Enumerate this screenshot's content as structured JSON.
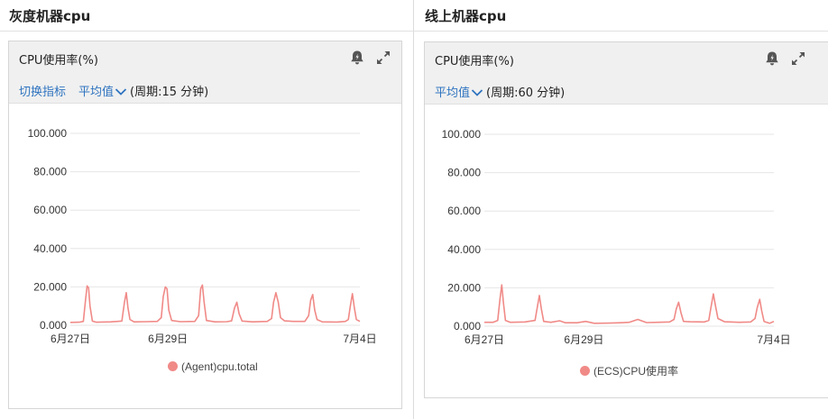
{
  "colors": {
    "link": "#2f74c0",
    "series": "#f08a87",
    "grid": "#e6e6e6"
  },
  "panels": [
    {
      "section_title": "灰度机器cpu",
      "card_title": "CPU使用率(%)",
      "alert_icon": "bell-alert-icon",
      "expand_icon": "expand-icon",
      "switch_metric_label": "切换指标",
      "aggregation_label": "平均值",
      "period_label": "(周期:15 分钟)",
      "legend_label": "(Agent)cpu.total",
      "chart_data": {
        "type": "line",
        "yticks": [
          "100.000",
          "80.000",
          "60.000",
          "40.000",
          "20.000",
          "0.000"
        ],
        "ylim": [
          0,
          100
        ],
        "x_tick_labels": [
          "6月27日",
          "6月29日",
          "7月4日"
        ],
        "x_tick_positions": [
          0.0,
          0.337,
          1.0
        ],
        "series": [
          {
            "name": "(Agent)cpu.total",
            "points": [
              [
                0.0,
                1.5
              ],
              [
                0.03,
                1.6
              ],
              [
                0.045,
                2.0
              ],
              [
                0.053,
                14.0
              ],
              [
                0.058,
                20.5
              ],
              [
                0.063,
                19.5
              ],
              [
                0.068,
                10.0
              ],
              [
                0.076,
                2.2
              ],
              [
                0.09,
                1.6
              ],
              [
                0.14,
                1.8
              ],
              [
                0.178,
                2.2
              ],
              [
                0.187,
                12.0
              ],
              [
                0.193,
                17.0
              ],
              [
                0.199,
                9.0
              ],
              [
                0.206,
                3.0
              ],
              [
                0.22,
                1.8
              ],
              [
                0.26,
                1.9
              ],
              [
                0.3,
                2.0
              ],
              [
                0.314,
                4.0
              ],
              [
                0.321,
                15.0
              ],
              [
                0.328,
                20.0
              ],
              [
                0.334,
                19.0
              ],
              [
                0.34,
                8.0
              ],
              [
                0.35,
                2.5
              ],
              [
                0.38,
                1.9
              ],
              [
                0.43,
                2.0
              ],
              [
                0.443,
                5.0
              ],
              [
                0.45,
                19.0
              ],
              [
                0.456,
                21.0
              ],
              [
                0.462,
                12.0
              ],
              [
                0.47,
                2.5
              ],
              [
                0.5,
                1.8
              ],
              [
                0.54,
                1.9
              ],
              [
                0.557,
                2.3
              ],
              [
                0.567,
                9.0
              ],
              [
                0.575,
                12.0
              ],
              [
                0.583,
                6.0
              ],
              [
                0.593,
                2.2
              ],
              [
                0.63,
                1.8
              ],
              [
                0.68,
                2.0
              ],
              [
                0.695,
                3.5
              ],
              [
                0.702,
                12.0
              ],
              [
                0.71,
                17.0
              ],
              [
                0.718,
                12.0
              ],
              [
                0.726,
                4.0
              ],
              [
                0.74,
                2.3
              ],
              [
                0.77,
                2.0
              ],
              [
                0.81,
                2.0
              ],
              [
                0.823,
                5.0
              ],
              [
                0.83,
                13.0
              ],
              [
                0.837,
                16.0
              ],
              [
                0.844,
                8.0
              ],
              [
                0.852,
                3.0
              ],
              [
                0.87,
                1.8
              ],
              [
                0.92,
                1.7
              ],
              [
                0.95,
                2.0
              ],
              [
                0.96,
                3.0
              ],
              [
                0.967,
                10.0
              ],
              [
                0.974,
                16.5
              ],
              [
                0.981,
                9.0
              ],
              [
                0.988,
                3.0
              ],
              [
                1.0,
                2.0
              ]
            ]
          }
        ]
      }
    },
    {
      "section_title": "线上机器cpu",
      "card_title": "CPU使用率(%)",
      "alert_icon": "bell-alert-icon",
      "expand_icon": "expand-icon",
      "switch_metric_label": "",
      "aggregation_label": "平均值",
      "period_label": "(周期:60 分钟)",
      "legend_label": "(ECS)CPU使用率",
      "chart_data": {
        "type": "line",
        "yticks": [
          "100.000",
          "80.000",
          "60.000",
          "40.000",
          "20.000",
          "0.000"
        ],
        "ylim": [
          0,
          100
        ],
        "x_tick_labels": [
          "6月27日",
          "6月29日",
          "7月4日"
        ],
        "x_tick_positions": [
          0.0,
          0.344,
          1.0
        ],
        "series": [
          {
            "name": "(ECS)CPU使用率",
            "points": [
              [
                0.0,
                2.0
              ],
              [
                0.03,
                2.0
              ],
              [
                0.046,
                3.0
              ],
              [
                0.054,
                14.0
              ],
              [
                0.06,
                21.5
              ],
              [
                0.066,
                12.0
              ],
              [
                0.073,
                3.0
              ],
              [
                0.09,
                2.0
              ],
              [
                0.14,
                2.2
              ],
              [
                0.175,
                3.0
              ],
              [
                0.184,
                11.0
              ],
              [
                0.19,
                16.0
              ],
              [
                0.197,
                9.0
              ],
              [
                0.205,
                2.5
              ],
              [
                0.23,
                2.0
              ],
              [
                0.26,
                2.8
              ],
              [
                0.28,
                1.8
              ],
              [
                0.32,
                1.8
              ],
              [
                0.35,
                2.5
              ],
              [
                0.38,
                1.5
              ],
              [
                0.43,
                1.6
              ],
              [
                0.47,
                1.8
              ],
              [
                0.5,
                2.0
              ],
              [
                0.53,
                3.5
              ],
              [
                0.56,
                1.9
              ],
              [
                0.6,
                2.0
              ],
              [
                0.64,
                2.2
              ],
              [
                0.655,
                3.5
              ],
              [
                0.663,
                9.0
              ],
              [
                0.671,
                12.5
              ],
              [
                0.679,
                7.0
              ],
              [
                0.688,
                2.5
              ],
              [
                0.71,
                2.3
              ],
              [
                0.76,
                2.2
              ],
              [
                0.775,
                3.0
              ],
              [
                0.783,
                10.0
              ],
              [
                0.791,
                16.8
              ],
              [
                0.799,
                10.0
              ],
              [
                0.807,
                4.0
              ],
              [
                0.83,
                2.3
              ],
              [
                0.88,
                2.0
              ],
              [
                0.92,
                2.2
              ],
              [
                0.935,
                4.0
              ],
              [
                0.943,
                10.0
              ],
              [
                0.951,
                14.0
              ],
              [
                0.958,
                8.0
              ],
              [
                0.966,
                2.5
              ],
              [
                0.985,
                1.5
              ],
              [
                1.0,
                2.5
              ]
            ]
          }
        ]
      }
    }
  ]
}
